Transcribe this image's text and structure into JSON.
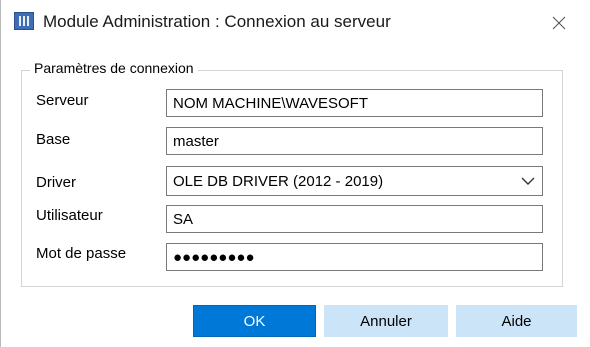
{
  "window": {
    "title": "Module Administration : Connexion au serveur",
    "app_icon": "database-admin-icon",
    "close_icon": "close-icon"
  },
  "group": {
    "legend": "Paramètres de connexion"
  },
  "fields": {
    "server": {
      "label": "Serveur",
      "value": "NOM MACHINE\\WAVESOFT"
    },
    "database": {
      "label": "Base",
      "value": "master"
    },
    "driver": {
      "label": "Driver",
      "value": "OLE DB DRIVER (2012 - 2019)"
    },
    "user": {
      "label": "Utilisateur",
      "value": "SA"
    },
    "password": {
      "label": "Mot de passe",
      "value": "●●●●●●●●●"
    }
  },
  "buttons": {
    "ok": "OK",
    "cancel": "Annuler",
    "help": "Aide"
  },
  "colors": {
    "primary_button": "#0078d7",
    "secondary_button": "#cce4f7"
  }
}
